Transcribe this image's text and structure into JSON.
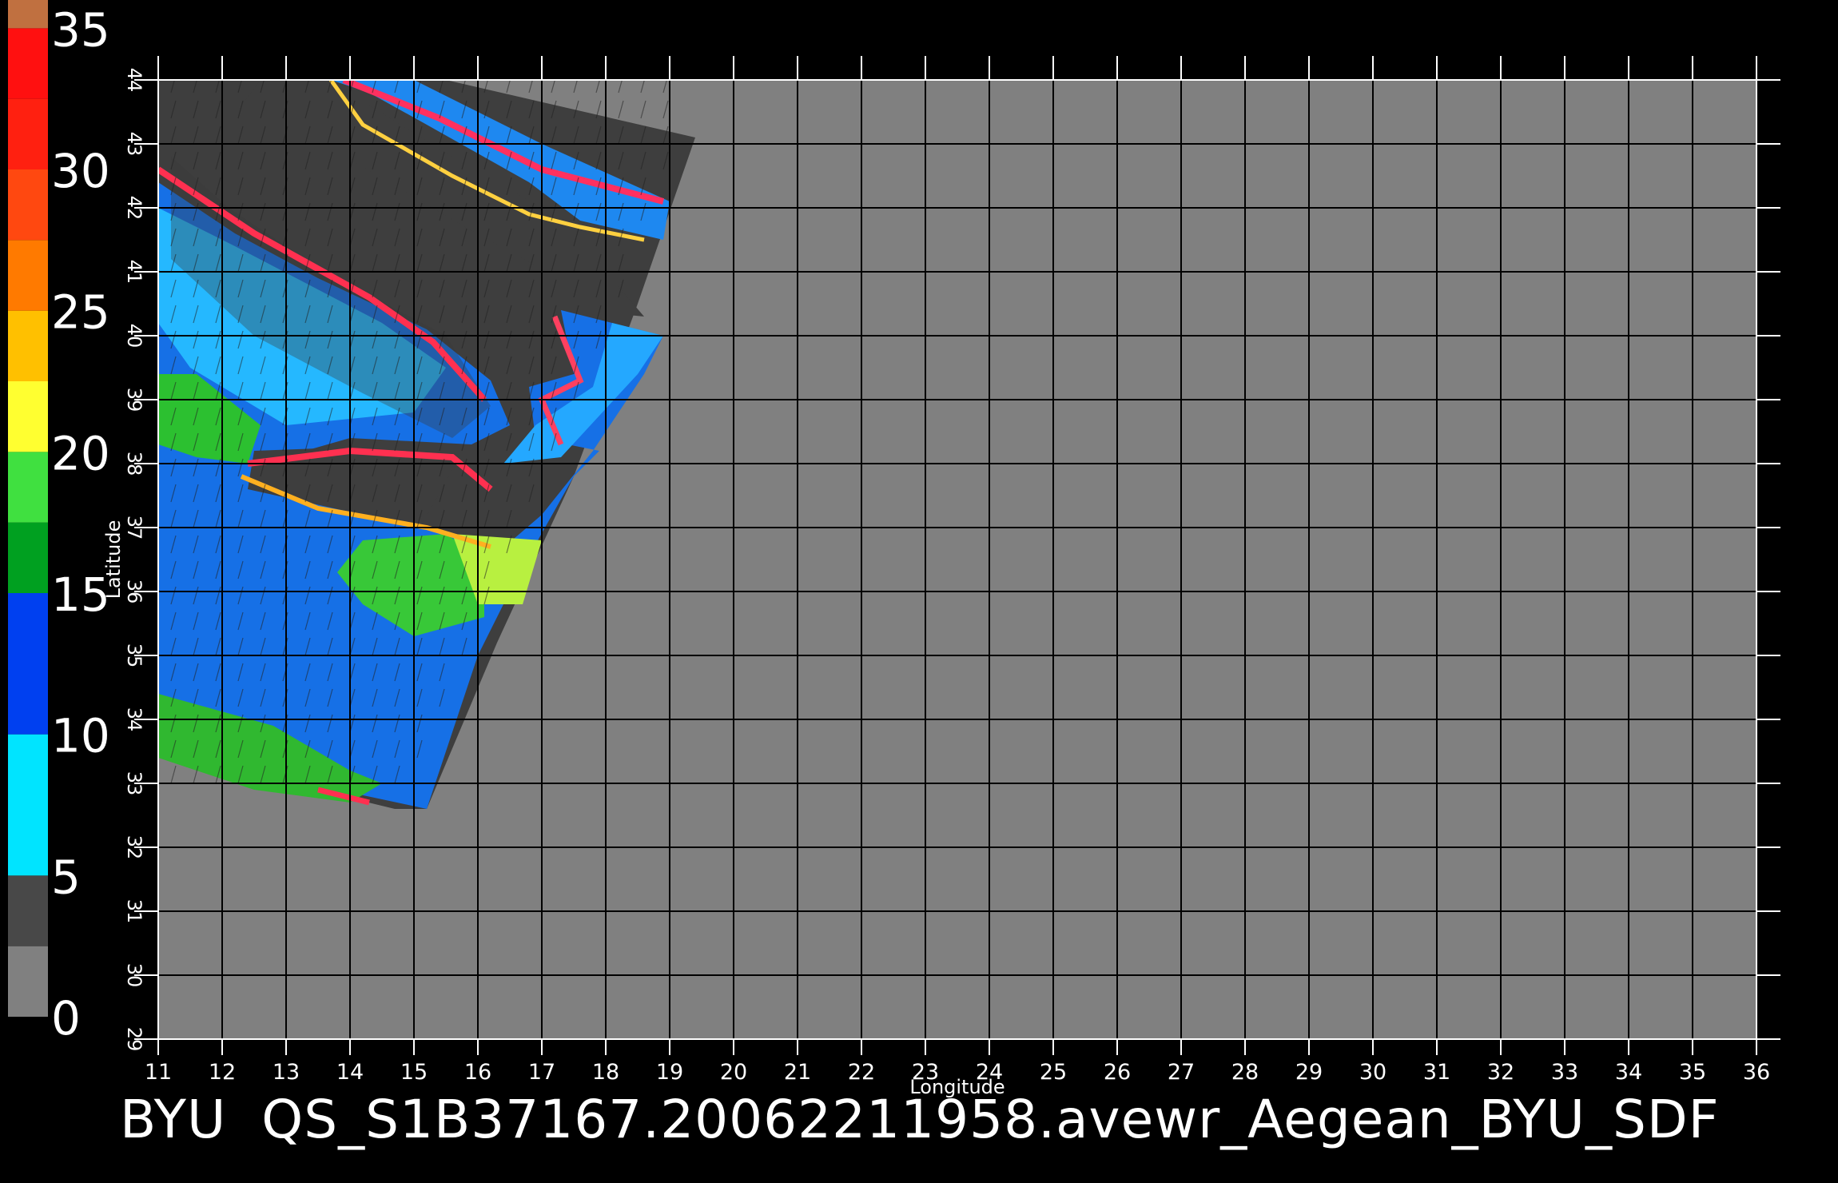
{
  "colorbar": {
    "ticks": [
      "0",
      "5",
      "10",
      "15",
      "20",
      "25",
      "30",
      "35"
    ],
    "segments": [
      {
        "from": 0,
        "to": 2.5,
        "color": "#808080"
      },
      {
        "from": 2.5,
        "to": 5,
        "color": "#484848"
      },
      {
        "from": 5,
        "to": 10,
        "color": "#00e4ff"
      },
      {
        "from": 10,
        "to": 15,
        "color": "#0040f0"
      },
      {
        "from": 15,
        "to": 17.5,
        "color": "#00a020"
      },
      {
        "from": 17.5,
        "to": 20,
        "color": "#40e040"
      },
      {
        "from": 20,
        "to": 22.5,
        "color": "#ffff30"
      },
      {
        "from": 22.5,
        "to": 25,
        "color": "#ffc000"
      },
      {
        "from": 25,
        "to": 27.5,
        "color": "#ff7a00"
      },
      {
        "from": 27.5,
        "to": 30,
        "color": "#ff4810"
      },
      {
        "from": 30,
        "to": 32.5,
        "color": "#ff2010"
      },
      {
        "from": 32.5,
        "to": 35,
        "color": "#ff1010"
      },
      {
        "from": 35,
        "to": 36,
        "color": "#c07040"
      }
    ],
    "range": [
      0,
      36
    ]
  },
  "map": {
    "lon_range": [
      11,
      36
    ],
    "lat_range": [
      29,
      44
    ],
    "lon_ticks": [
      "11",
      "12",
      "13",
      "14",
      "15",
      "16",
      "17",
      "18",
      "19",
      "20",
      "21",
      "22",
      "23",
      "24",
      "25",
      "26",
      "27",
      "28",
      "29",
      "30",
      "31",
      "32",
      "33",
      "34",
      "35",
      "36"
    ],
    "lat_ticks": [
      "29",
      "30",
      "31",
      "32",
      "33",
      "34",
      "35",
      "36",
      "37",
      "38",
      "39",
      "40",
      "41",
      "42",
      "43",
      "44"
    ],
    "xlabel": "Longitude",
    "ylabel": "Latitude",
    "background_color": "#808080",
    "grid_color": "#000000"
  },
  "caption": "BYU  QS_S1B37167.20062211958.avewr_Aegean_BYU_SDF"
}
